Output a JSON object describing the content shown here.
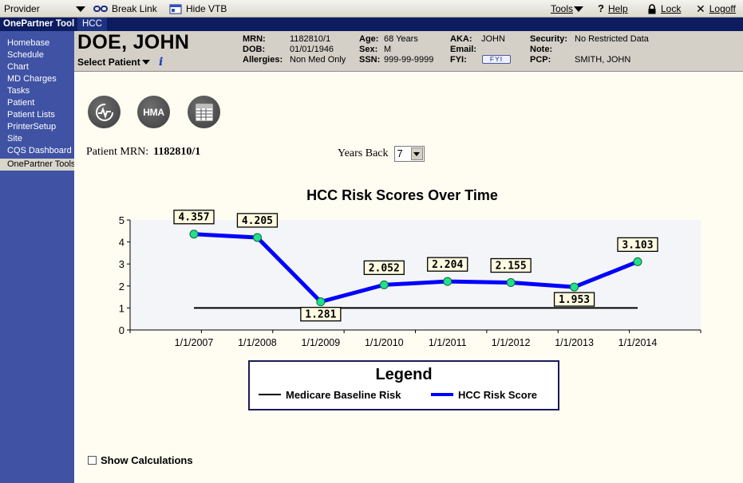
{
  "topbar": {
    "provider_label": "Provider",
    "break_link": "Break Link",
    "hide_vtb": "Hide VTB",
    "tools": "Tools",
    "help": "Help",
    "lock": "Lock",
    "logoff": "Logoff"
  },
  "sidebar": {
    "title": "OnePartner Tools",
    "items": [
      {
        "label": "Homebase"
      },
      {
        "label": "Schedule"
      },
      {
        "label": "Chart"
      },
      {
        "label": "MD Charges"
      },
      {
        "label": "Tasks"
      },
      {
        "label": "Patient"
      },
      {
        "label": "Patient Lists"
      },
      {
        "label": "PrinterSetup"
      },
      {
        "label": "Site"
      },
      {
        "label": "CQS Dashboard"
      },
      {
        "label": "OnePartner Tools"
      }
    ]
  },
  "tabs": {
    "active": "HCC"
  },
  "patient": {
    "name": "DOE, JOHN",
    "select_label": "Select Patient",
    "mrn_label": "MRN:",
    "mrn": "1182810/1",
    "dob_label": "DOB:",
    "dob": "01/01/1946",
    "allergies_label": "Allergies:",
    "allergies": "Non Med Only",
    "age_label": "Age:",
    "age": "68 Years",
    "sex_label": "Sex:",
    "sex": "M",
    "ssn_label": "SSN:",
    "ssn": "999-99-9999",
    "aka_label": "AKA:",
    "aka": "JOHN",
    "email_label": "Email:",
    "email": "",
    "fyi_label": "FYI:",
    "fyi_button": "FYI",
    "security_label": "Security:",
    "security": "No Restricted Data",
    "note_label": "Note:",
    "note": "",
    "pcp_label": "PCP:",
    "pcp": "SMITH, JOHN"
  },
  "content": {
    "hma_label": "HMA",
    "patient_mrn_label": "Patient MRN:",
    "patient_mrn": "1182810/1",
    "years_back_label": "Years Back",
    "years_back_value": "7",
    "show_calculations": "Show Calculations"
  },
  "colors": {
    "sidebar": "#3f52a4",
    "header_dark": "#0c1c5f",
    "series_hcc": "#0000ff",
    "marker": "#22e08a",
    "plot_bg": "#f4f5f8"
  },
  "chart_data": {
    "type": "line",
    "title": "HCC Risk Scores Over Time",
    "x": [
      "1/1/2007",
      "1/1/2008",
      "1/1/2009",
      "1/1/2010",
      "1/1/2011",
      "1/1/2012",
      "1/1/2013",
      "1/1/2014"
    ],
    "series": [
      {
        "name": "Medicare Baseline Risk",
        "values": [
          1,
          1,
          1,
          1,
          1,
          1,
          1,
          1
        ],
        "color": "#000000"
      },
      {
        "name": "HCC Risk Score",
        "values": [
          4.357,
          4.205,
          1.281,
          2.052,
          2.204,
          2.155,
          1.953,
          3.103
        ],
        "color": "#0000ff"
      }
    ],
    "data_labels": [
      "4.357",
      "4.205",
      "1.281",
      "2.052",
      "2.204",
      "2.155",
      "1.953",
      "3.103"
    ],
    "yticks": [
      "0",
      "1",
      "2",
      "3",
      "4",
      "5"
    ],
    "ylim": [
      0,
      5
    ],
    "legend_title": "Legend",
    "legend_position": "bottom",
    "grid": false
  }
}
